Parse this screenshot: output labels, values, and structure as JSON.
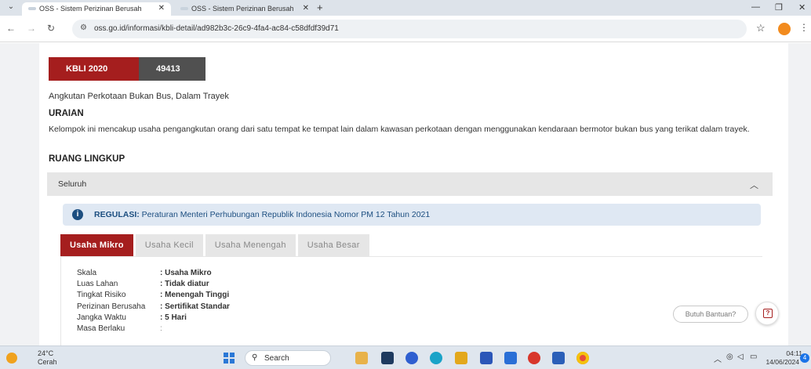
{
  "browser": {
    "tabs": [
      {
        "title": "OSS - Sistem Perizinan Berusah",
        "close": "✕"
      },
      {
        "title": "OSS - Sistem Perizinan Berusah",
        "close": "✕"
      }
    ],
    "new_tab": "+",
    "url": "oss.go.id/informasi/kbli-detail/ad982b3c-26c9-4fa4-ac84-c58dfdf39d71",
    "profile_initial": "D"
  },
  "kbli": {
    "label": "KBLI 2020",
    "code": "49413"
  },
  "subtitle": "Angkutan Perkotaan Bukan Bus, Dalam Trayek",
  "uraian": {
    "heading": "URAIAN",
    "text": "Kelompok ini mencakup usaha pengangkutan orang dari satu tempat ke tempat lain dalam kawasan perkotaan dengan menggunakan kendaraan bermotor bukan bus yang terikat dalam trayek."
  },
  "ruang_lingkup": {
    "heading": "RUANG LINGKUP",
    "accordion_label": "Seluruh"
  },
  "regulasi": {
    "label": "REGULASI:",
    "text": "Peraturan Menteri Perhubungan Republik Indonesia Nomor PM 12 Tahun 2021"
  },
  "scale_tabs": [
    "Usaha Mikro",
    "Usaha Kecil",
    "Usaha Menengah",
    "Usaha Besar"
  ],
  "details": [
    {
      "label": "Skala",
      "value": ": Usaha Mikro"
    },
    {
      "label": "Luas Lahan",
      "value": ": Tidak diatur"
    },
    {
      "label": "Tingkat Risiko",
      "value": ": Menengah Tinggi"
    },
    {
      "label": "Perizinan Berusaha",
      "value": ": Sertifikat Standar"
    },
    {
      "label": "Jangka Waktu",
      "value": ": 5 Hari"
    },
    {
      "label": "Masa Berlaku",
      "value": ":"
    }
  ],
  "help": {
    "pill": "Butuh Bantuan?",
    "icon": "?"
  },
  "taskbar": {
    "temp": "24°C",
    "condition": "Cerah",
    "search": "Search",
    "time": "04:11",
    "date": "14/06/2024",
    "notifications": "4"
  }
}
